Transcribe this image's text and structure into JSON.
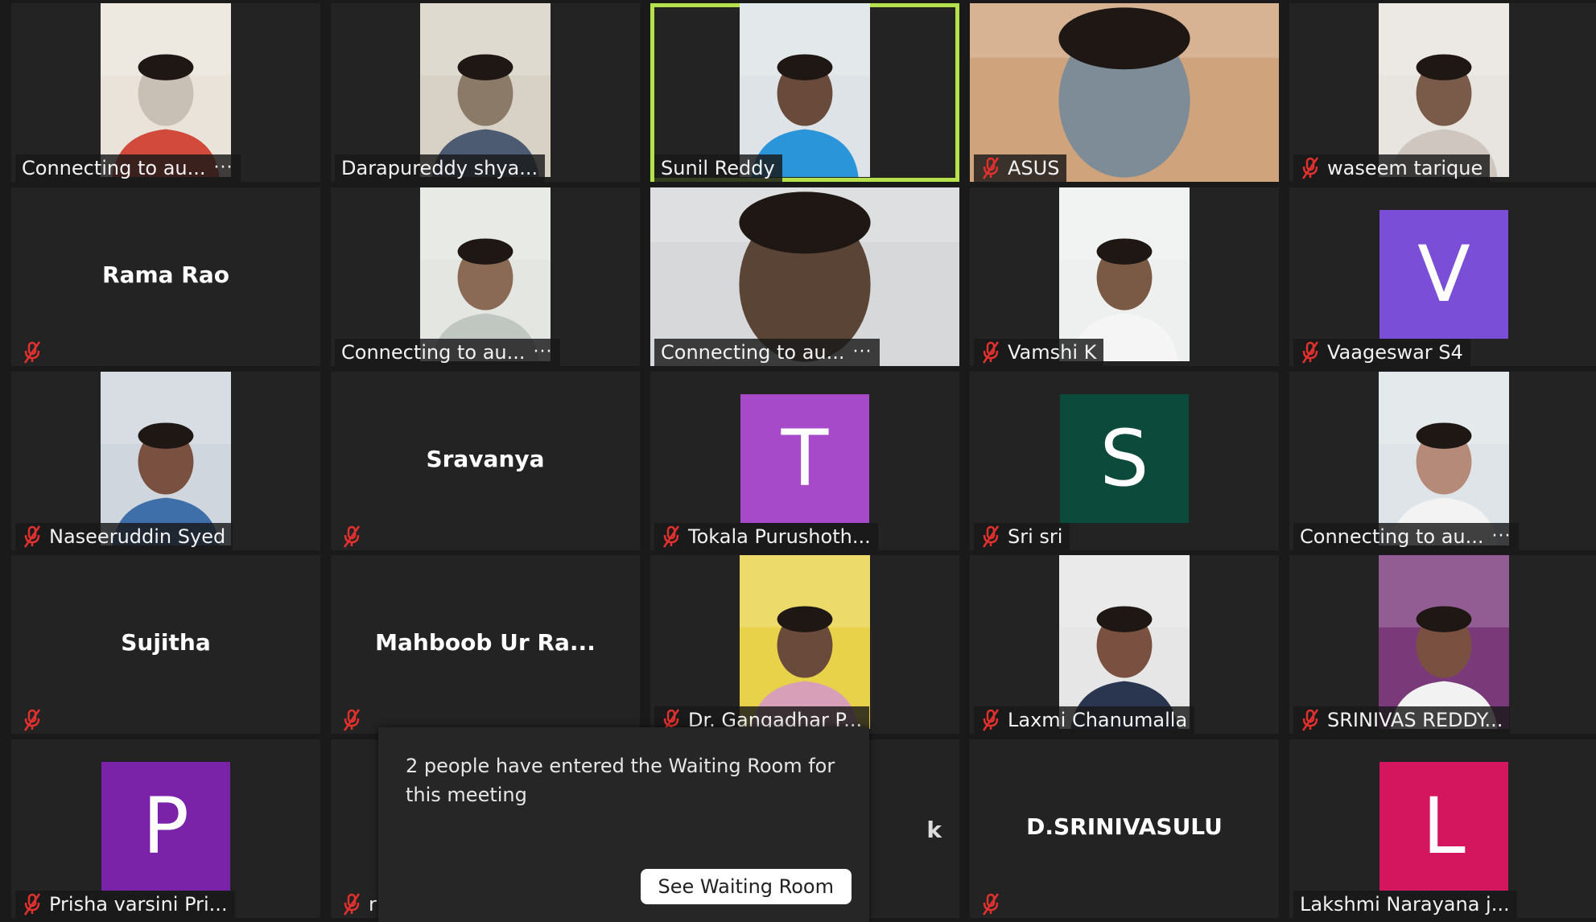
{
  "colors": {
    "tile_bg": "#232323",
    "active_speaker_border": "#b7e14a",
    "muted_mic": "#e0312f",
    "label_bg": "#191919"
  },
  "icons": {
    "muted": "mic-muted-icon",
    "more": "more-dots-icon"
  },
  "participants": [
    {
      "name": "Connecting to au...",
      "kind": "video",
      "muted": false,
      "more": true,
      "photo": "portrait",
      "tone": [
        "#e9e3da",
        "#c8c0b4",
        "#d24a3b"
      ]
    },
    {
      "name": "Darapureddy shya...",
      "kind": "video",
      "muted": false,
      "more": false,
      "photo": "portrait",
      "tone": [
        "#d8d2c6",
        "#8c7a68",
        "#4c5a72"
      ]
    },
    {
      "name": "Sunil Reddy",
      "kind": "video",
      "muted": false,
      "more": false,
      "photo": "portrait",
      "active": true,
      "tone": [
        "#dde3e6",
        "#6a4a3a",
        "#2a95d8"
      ]
    },
    {
      "name": "ASUS",
      "kind": "video",
      "muted": true,
      "more": false,
      "photo": "full",
      "tone": [
        "#cfa37c",
        "#7d8c96",
        "#9fb0bd"
      ]
    },
    {
      "name": "waseem tarique",
      "kind": "video",
      "muted": true,
      "more": false,
      "photo": "portrait",
      "tone": [
        "#e8e4e0",
        "#7a5a48",
        "#cfc7bf"
      ]
    },
    {
      "name": "Rama Rao",
      "kind": "name",
      "muted": true,
      "more": false
    },
    {
      "name": "Connecting to au...",
      "kind": "video",
      "muted": false,
      "more": true,
      "photo": "portrait",
      "tone": [
        "#e3e6e1",
        "#8a6a54",
        "#bfc7c0"
      ]
    },
    {
      "name": "Connecting to au...",
      "kind": "video",
      "muted": false,
      "more": true,
      "photo": "full",
      "tone": [
        "#d6d8da",
        "#5a4436",
        "#e9eaec"
      ]
    },
    {
      "name": "Vamshi K",
      "kind": "video",
      "muted": true,
      "more": false,
      "photo": "portrait",
      "tone": [
        "#eef0f0",
        "#7a5a45",
        "#f5f5f5"
      ]
    },
    {
      "name": "Vaageswar S4",
      "kind": "avatar",
      "letter": "V",
      "color": "#7a4ed6",
      "muted": true,
      "more": false
    },
    {
      "name": "Naseeruddin Syed",
      "kind": "video",
      "muted": true,
      "more": false,
      "photo": "portrait",
      "tone": [
        "#cfd6dd",
        "#7a5040",
        "#3f6fa8"
      ]
    },
    {
      "name": "Sravanya",
      "kind": "name",
      "muted": true,
      "more": false
    },
    {
      "name": "Tokala Purushoth...",
      "kind": "avatar",
      "letter": "T",
      "color": "#a64ac9",
      "muted": true,
      "more": false
    },
    {
      "name": "Sri sri",
      "kind": "avatar",
      "letter": "S",
      "color": "#0c4a3c",
      "muted": true,
      "more": false
    },
    {
      "name": "Connecting to au...",
      "kind": "video",
      "muted": false,
      "more": true,
      "photo": "portrait",
      "tone": [
        "#dfe4e8",
        "#b58a78",
        "#f3f3f3"
      ]
    },
    {
      "name": "Sujitha",
      "kind": "name",
      "muted": true,
      "more": false
    },
    {
      "name": "Mahboob Ur Ra...",
      "kind": "name",
      "muted": true,
      "more": false
    },
    {
      "name": "Dr. Gangadhar P...",
      "kind": "video",
      "muted": true,
      "more": false,
      "photo": "portrait",
      "tone": [
        "#e8d24a",
        "#6a4a3a",
        "#d8a0b8"
      ]
    },
    {
      "name": "Laxmi Chanumalla",
      "kind": "video",
      "muted": true,
      "more": false,
      "photo": "portrait",
      "tone": [
        "#e6e6e6",
        "#7a5040",
        "#2a3550"
      ]
    },
    {
      "name": "SRINIVAS REDDY...",
      "kind": "video",
      "muted": true,
      "more": false,
      "photo": "portrait",
      "tone": [
        "#7a3a7a",
        "#7a5040",
        "#f2f2f2"
      ]
    },
    {
      "name": "Prisha varsini Pri...",
      "kind": "avatar",
      "letter": "P",
      "color": "#7a22a8",
      "muted": true,
      "more": false
    },
    {
      "name": "r",
      "kind": "name",
      "center": "",
      "muted": true,
      "more": false
    },
    {
      "name": "",
      "kind": "peek",
      "peek": "k",
      "muted": false,
      "more": false
    },
    {
      "name": "D.SRINIVASULU",
      "kind": "name",
      "muted": true,
      "more": false,
      "hideLabel": true
    },
    {
      "name": "Lakshmi Narayana j...",
      "kind": "avatar",
      "letter": "L",
      "color": "#d3165e",
      "muted": false,
      "more": false
    }
  ],
  "waiting_room": {
    "message": "2 people have entered the Waiting Room for this meeting",
    "button_label": "See Waiting Room"
  }
}
